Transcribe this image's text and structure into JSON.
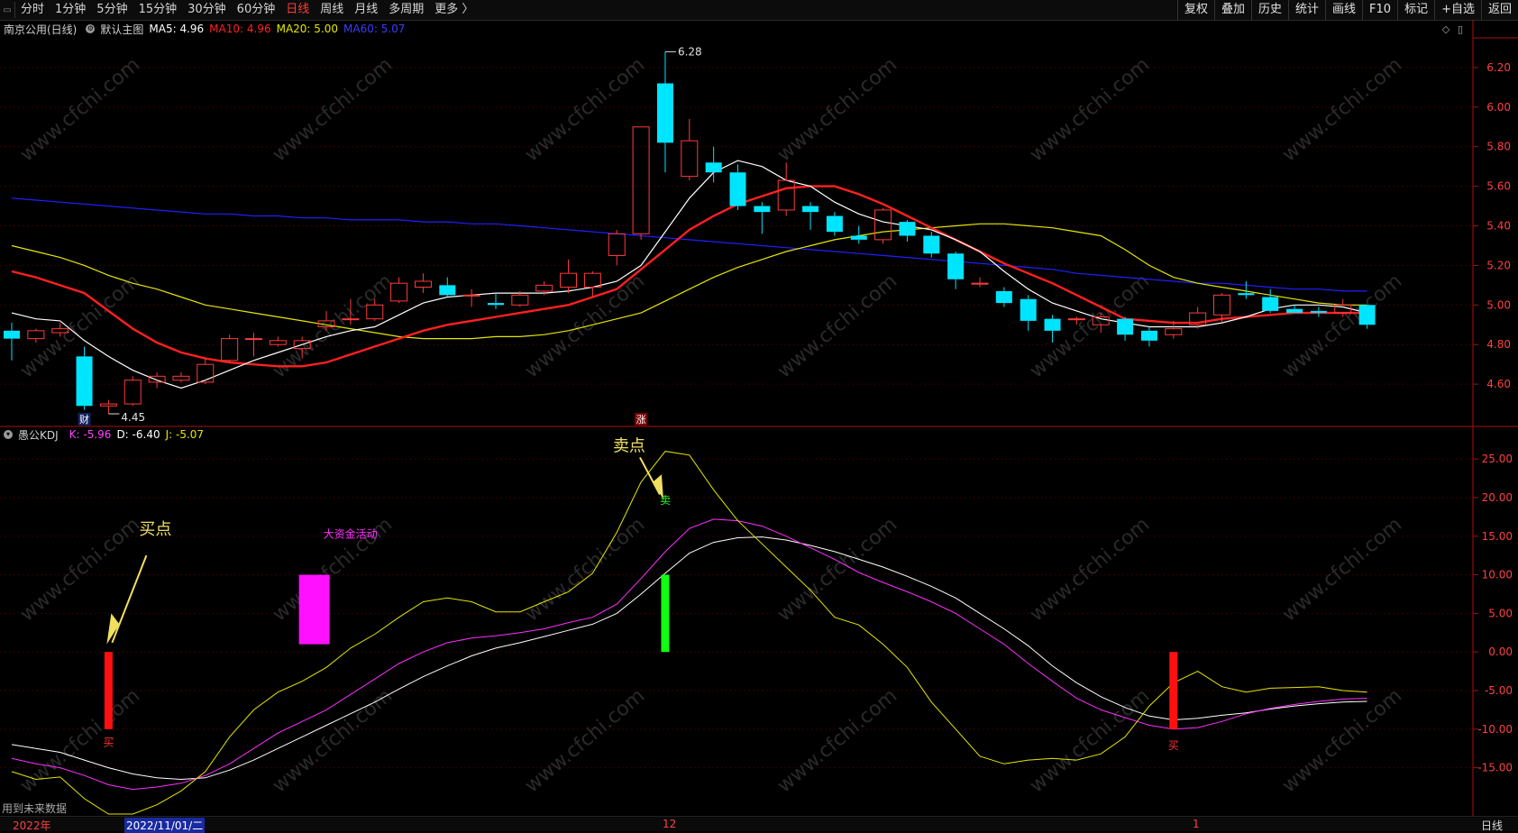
{
  "toolbar": {
    "tabs": [
      "分时",
      "1分钟",
      "5分钟",
      "15分钟",
      "30分钟",
      "60分钟",
      "日线",
      "周线",
      "月线",
      "多周期",
      "更多 〉"
    ],
    "active_tab": "日线",
    "right_buttons": [
      "复权",
      "叠加",
      "历史",
      "统计",
      "画线",
      "F10",
      "标记",
      "+自选",
      "返回"
    ]
  },
  "main_chart": {
    "stock": "南京公用(日线)",
    "indicator_name": "默认主图",
    "ma5": "MA5: 4.96",
    "ma10": "MA10: 4.96",
    "ma20": "MA20: 5.00",
    "ma60": "MA60: 5.07",
    "colors": {
      "ma5": "#ffffff",
      "ma10": "#ff2020",
      "ma20": "#e6e600",
      "ma60": "#2020ff",
      "up": "#ff3b3b",
      "down": "#00e5ff"
    },
    "high_label": "6.28",
    "low_label": "4.45",
    "badge_cai": "财",
    "badge_zhang": "涨",
    "y_ticks": [
      "6.20",
      "6.00",
      "5.80",
      "5.60",
      "5.40",
      "5.20",
      "5.00",
      "4.80",
      "4.60"
    ]
  },
  "kdj_chart": {
    "name": "愚公KDJ",
    "k": "K: -5.96",
    "d": "D: -6.40",
    "j": "J: -5.07",
    "y_ticks": [
      "25.00",
      "20.00",
      "15.00",
      "10.00",
      "5.00",
      "0.00",
      "-5.00",
      "-10.00",
      "-15.00"
    ],
    "buy_point_label": "买点",
    "sell_point_label": "卖点",
    "big_money_label": "大资金活动",
    "buy_tag": "买",
    "sell_tag": "卖",
    "buy_tag2": "买"
  },
  "chart_data": {
    "type": "candlestick",
    "y_range": [
      4.4,
      6.35
    ],
    "candles": [
      {
        "o": 4.87,
        "c": 4.83,
        "h": 4.91,
        "l": 4.72
      },
      {
        "o": 4.83,
        "c": 4.87,
        "h": 4.88,
        "l": 4.81
      },
      {
        "o": 4.86,
        "c": 4.88,
        "h": 4.91,
        "l": 4.84
      },
      {
        "o": 4.74,
        "c": 4.49,
        "h": 4.79,
        "l": 4.47
      },
      {
        "o": 4.49,
        "c": 4.5,
        "h": 4.52,
        "l": 4.45
      },
      {
        "o": 4.5,
        "c": 4.62,
        "h": 4.64,
        "l": 4.49
      },
      {
        "o": 4.61,
        "c": 4.64,
        "h": 4.66,
        "l": 4.58
      },
      {
        "o": 4.62,
        "c": 4.64,
        "h": 4.66,
        "l": 4.61
      },
      {
        "o": 4.61,
        "c": 4.7,
        "h": 4.73,
        "l": 4.6
      },
      {
        "o": 4.72,
        "c": 4.83,
        "h": 4.85,
        "l": 4.71
      },
      {
        "o": 4.83,
        "c": 4.83,
        "h": 4.86,
        "l": 4.74
      },
      {
        "o": 4.8,
        "c": 4.82,
        "h": 4.84,
        "l": 4.79
      },
      {
        "o": 4.78,
        "c": 4.82,
        "h": 4.84,
        "l": 4.73
      },
      {
        "o": 4.89,
        "c": 4.92,
        "h": 4.97,
        "l": 4.87
      },
      {
        "o": 4.93,
        "c": 4.93,
        "h": 5.03,
        "l": 4.9
      },
      {
        "o": 4.93,
        "c": 5.0,
        "h": 5.03,
        "l": 4.92
      },
      {
        "o": 5.02,
        "c": 5.11,
        "h": 5.14,
        "l": 5.01
      },
      {
        "o": 5.09,
        "c": 5.12,
        "h": 5.16,
        "l": 5.06
      },
      {
        "o": 5.1,
        "c": 5.05,
        "h": 5.14,
        "l": 5.04
      },
      {
        "o": 5.05,
        "c": 5.05,
        "h": 5.08,
        "l": 4.99
      },
      {
        "o": 5.01,
        "c": 5.0,
        "h": 5.06,
        "l": 4.98
      },
      {
        "o": 5.0,
        "c": 5.05,
        "h": 5.07,
        "l": 4.99
      },
      {
        "o": 5.07,
        "c": 5.1,
        "h": 5.12,
        "l": 5.05
      },
      {
        "o": 5.09,
        "c": 5.16,
        "h": 5.23,
        "l": 5.06
      },
      {
        "o": 5.09,
        "c": 5.16,
        "h": 5.17,
        "l": 5.04
      },
      {
        "o": 5.25,
        "c": 5.36,
        "h": 5.38,
        "l": 5.2
      },
      {
        "o": 5.36,
        "c": 5.9,
        "h": 5.9,
        "l": 5.33
      },
      {
        "o": 6.12,
        "c": 5.82,
        "h": 6.28,
        "l": 5.67
      },
      {
        "o": 5.65,
        "c": 5.83,
        "h": 5.94,
        "l": 5.63
      },
      {
        "o": 5.72,
        "c": 5.67,
        "h": 5.8,
        "l": 5.62
      },
      {
        "o": 5.67,
        "c": 5.5,
        "h": 5.71,
        "l": 5.48
      },
      {
        "o": 5.5,
        "c": 5.47,
        "h": 5.52,
        "l": 5.36
      },
      {
        "o": 5.48,
        "c": 5.63,
        "h": 5.72,
        "l": 5.45
      },
      {
        "o": 5.5,
        "c": 5.47,
        "h": 5.52,
        "l": 5.38
      },
      {
        "o": 5.45,
        "c": 5.37,
        "h": 5.47,
        "l": 5.35
      },
      {
        "o": 5.35,
        "c": 5.33,
        "h": 5.4,
        "l": 5.31
      },
      {
        "o": 5.33,
        "c": 5.48,
        "h": 5.49,
        "l": 5.31
      },
      {
        "o": 5.42,
        "c": 5.35,
        "h": 5.43,
        "l": 5.32
      },
      {
        "o": 5.35,
        "c": 5.26,
        "h": 5.37,
        "l": 5.24
      },
      {
        "o": 5.26,
        "c": 5.13,
        "h": 5.27,
        "l": 5.08
      },
      {
        "o": 5.11,
        "c": 5.11,
        "h": 5.14,
        "l": 5.09
      },
      {
        "o": 5.07,
        "c": 5.01,
        "h": 5.09,
        "l": 4.99
      },
      {
        "o": 5.03,
        "c": 4.92,
        "h": 5.05,
        "l": 4.87
      },
      {
        "o": 4.93,
        "c": 4.87,
        "h": 4.95,
        "l": 4.81
      },
      {
        "o": 4.93,
        "c": 4.93,
        "h": 4.94,
        "l": 4.9
      },
      {
        "o": 4.9,
        "c": 4.94,
        "h": 4.96,
        "l": 4.86
      },
      {
        "o": 4.93,
        "c": 4.85,
        "h": 4.94,
        "l": 4.82
      },
      {
        "o": 4.87,
        "c": 4.82,
        "h": 4.89,
        "l": 4.79
      },
      {
        "o": 4.85,
        "c": 4.88,
        "h": 4.92,
        "l": 4.83
      },
      {
        "o": 4.9,
        "c": 4.96,
        "h": 4.99,
        "l": 4.88
      },
      {
        "o": 4.95,
        "c": 5.05,
        "h": 5.06,
        "l": 4.91
      },
      {
        "o": 5.06,
        "c": 5.05,
        "h": 5.12,
        "l": 5.03
      },
      {
        "o": 5.04,
        "c": 4.97,
        "h": 5.08,
        "l": 4.96
      },
      {
        "o": 4.98,
        "c": 4.96,
        "h": 5.0,
        "l": 4.96
      },
      {
        "o": 4.97,
        "c": 4.96,
        "h": 4.99,
        "l": 4.94
      },
      {
        "o": 4.96,
        "c": 5.0,
        "h": 5.03,
        "l": 4.94
      },
      {
        "o": 5.0,
        "c": 4.9,
        "h": 5.0,
        "l": 4.88
      }
    ],
    "ma5": [
      4.96,
      4.93,
      4.92,
      4.82,
      4.74,
      4.67,
      4.62,
      4.58,
      4.62,
      4.67,
      4.72,
      4.76,
      4.8,
      4.84,
      4.87,
      4.89,
      4.95,
      5.01,
      5.04,
      5.05,
      5.06,
      5.06,
      5.06,
      5.07,
      5.09,
      5.12,
      5.2,
      5.37,
      5.54,
      5.67,
      5.73,
      5.7,
      5.63,
      5.6,
      5.52,
      5.46,
      5.42,
      5.4,
      5.38,
      5.33,
      5.27,
      5.17,
      5.08,
      5.01,
      4.97,
      4.93,
      4.91,
      4.89,
      4.89,
      4.89,
      4.91,
      4.94,
      4.98,
      5.0,
      5.0,
      4.99,
      4.96
    ],
    "ma10": [
      5.17,
      5.14,
      5.1,
      5.06,
      4.97,
      4.88,
      4.81,
      4.76,
      4.73,
      4.71,
      4.7,
      4.69,
      4.69,
      4.71,
      4.75,
      4.79,
      4.83,
      4.87,
      4.9,
      4.92,
      4.94,
      4.96,
      4.98,
      5.0,
      5.04,
      5.08,
      5.18,
      5.28,
      5.38,
      5.45,
      5.51,
      5.55,
      5.59,
      5.6,
      5.6,
      5.56,
      5.51,
      5.45,
      5.39,
      5.33,
      5.27,
      5.21,
      5.16,
      5.11,
      5.05,
      4.99,
      4.93,
      4.92,
      4.91,
      4.91,
      4.93,
      4.94,
      4.95,
      4.96,
      4.96,
      4.96,
      4.96
    ],
    "ma20": [
      5.3,
      5.27,
      5.24,
      5.2,
      5.15,
      5.11,
      5.08,
      5.04,
      5.0,
      4.98,
      4.96,
      4.94,
      4.92,
      4.9,
      4.88,
      4.86,
      4.84,
      4.83,
      4.83,
      4.83,
      4.84,
      4.84,
      4.85,
      4.87,
      4.9,
      4.93,
      4.96,
      5.02,
      5.08,
      5.14,
      5.19,
      5.23,
      5.27,
      5.3,
      5.33,
      5.35,
      5.37,
      5.38,
      5.39,
      5.4,
      5.41,
      5.41,
      5.4,
      5.39,
      5.37,
      5.35,
      5.28,
      5.2,
      5.14,
      5.11,
      5.09,
      5.07,
      5.05,
      5.03,
      5.01,
      5.0,
      5.0
    ],
    "ma60": [
      5.54,
      5.53,
      5.52,
      5.51,
      5.5,
      5.49,
      5.48,
      5.47,
      5.46,
      5.46,
      5.45,
      5.45,
      5.44,
      5.44,
      5.43,
      5.43,
      5.43,
      5.42,
      5.42,
      5.41,
      5.41,
      5.4,
      5.39,
      5.38,
      5.37,
      5.36,
      5.35,
      5.34,
      5.33,
      5.32,
      5.31,
      5.3,
      5.29,
      5.28,
      5.27,
      5.26,
      5.25,
      5.24,
      5.23,
      5.22,
      5.21,
      5.2,
      5.19,
      5.18,
      5.16,
      5.15,
      5.14,
      5.13,
      5.12,
      5.11,
      5.11,
      5.1,
      5.09,
      5.08,
      5.08,
      5.07,
      5.07
    ],
    "kdj_y_range": [
      -21,
      27
    ],
    "kdj_k": [
      -13.8,
      -14.5,
      -15.0,
      -16.0,
      -17.2,
      -17.8,
      -17.5,
      -17.0,
      -16.0,
      -14.5,
      -12.5,
      -10.5,
      -9.0,
      -7.5,
      -5.5,
      -3.5,
      -1.5,
      0.0,
      1.2,
      1.8,
      2.1,
      2.5,
      3.0,
      3.8,
      4.5,
      6.2,
      9.5,
      13.0,
      16.0,
      17.2,
      17.0,
      16.3,
      15.0,
      13.5,
      12.0,
      10.3,
      9.0,
      7.8,
      6.5,
      5.0,
      3.0,
      1.0,
      -1.5,
      -3.8,
      -6.0,
      -7.5,
      -8.5,
      -9.5,
      -10.0,
      -9.8,
      -9.0,
      -8.0,
      -7.3,
      -6.8,
      -6.4,
      -6.1,
      -6.0
    ],
    "kdj_d": [
      -12.0,
      -12.5,
      -13.0,
      -14.0,
      -15.0,
      -15.8,
      -16.3,
      -16.5,
      -16.3,
      -15.3,
      -14.0,
      -12.5,
      -11.0,
      -9.5,
      -8.0,
      -6.5,
      -4.8,
      -3.2,
      -1.8,
      -0.5,
      0.5,
      1.2,
      2.0,
      2.8,
      3.6,
      5.0,
      7.5,
      10.2,
      12.8,
      14.2,
      14.8,
      14.9,
      14.5,
      13.8,
      13.0,
      12.0,
      11.0,
      9.8,
      8.5,
      7.0,
      5.0,
      3.0,
      0.8,
      -1.8,
      -4.0,
      -5.8,
      -7.2,
      -8.3,
      -8.8,
      -8.6,
      -8.2,
      -7.9,
      -7.4,
      -7.0,
      -6.7,
      -6.5,
      -6.4
    ],
    "kdj_j": [
      -15.5,
      -16.5,
      -16.2,
      -19.0,
      -21.0,
      -21.0,
      -19.8,
      -18.0,
      -15.5,
      -11.0,
      -7.5,
      -5.2,
      -3.8,
      -2.0,
      0.5,
      2.3,
      4.5,
      6.5,
      7.0,
      6.5,
      5.2,
      5.2,
      6.5,
      7.8,
      10.2,
      15.5,
      22.0,
      26.0,
      25.5,
      21.0,
      17.0,
      14.0,
      11.0,
      8.0,
      4.5,
      3.5,
      1.0,
      -2.0,
      -6.5,
      -10.0,
      -13.5,
      -14.5,
      -14.0,
      -13.8,
      -14.0,
      -13.2,
      -11.0,
      -7.0,
      -4.0,
      -2.5,
      -4.5,
      -5.2,
      -4.7,
      -4.6,
      -4.5,
      -5.0,
      -5.2
    ]
  },
  "signals": {
    "buy1_index": 4,
    "sell_index": 27,
    "buy2_index": 48,
    "big_money_start": 12,
    "big_money_end": 13,
    "big_money_range": [
      1.0,
      10.0
    ],
    "buy_bar_range": [
      -10.0,
      0.0
    ],
    "sell_bar_range": [
      0.0,
      10.0
    ]
  },
  "bottom": {
    "year": "2022年",
    "date": "2022/11/01/二",
    "month12": "12",
    "month1": "1",
    "period": "日线",
    "future_note": "用到未来数据"
  },
  "watermark": "www.cfchi.com"
}
